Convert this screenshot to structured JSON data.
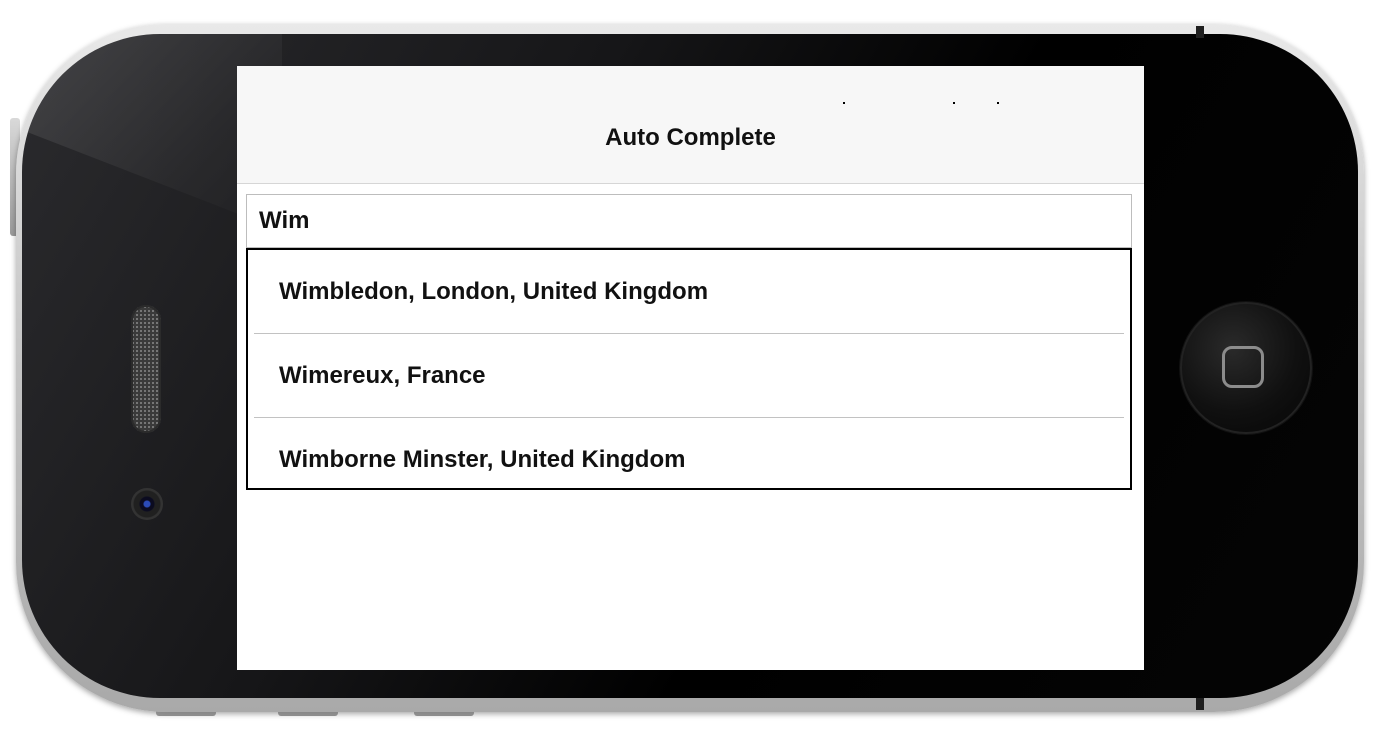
{
  "app": {
    "title": "Auto Complete"
  },
  "search": {
    "value": "Wim"
  },
  "suggestions": [
    {
      "label": "Wimbledon, London, United Kingdom"
    },
    {
      "label": "Wimereux, France"
    },
    {
      "label": "Wimborne Minster, United Kingdom"
    }
  ],
  "colors": {
    "nav_background": "#f7f7f7",
    "screen_background": "#ffffff",
    "dropdown_border": "#000000",
    "separator": "#c2c2c2",
    "device_body": "#000000"
  },
  "icons": {
    "home_button": "home-square-icon",
    "camera": "camera-icon",
    "speaker": "speaker-grille-icon"
  }
}
